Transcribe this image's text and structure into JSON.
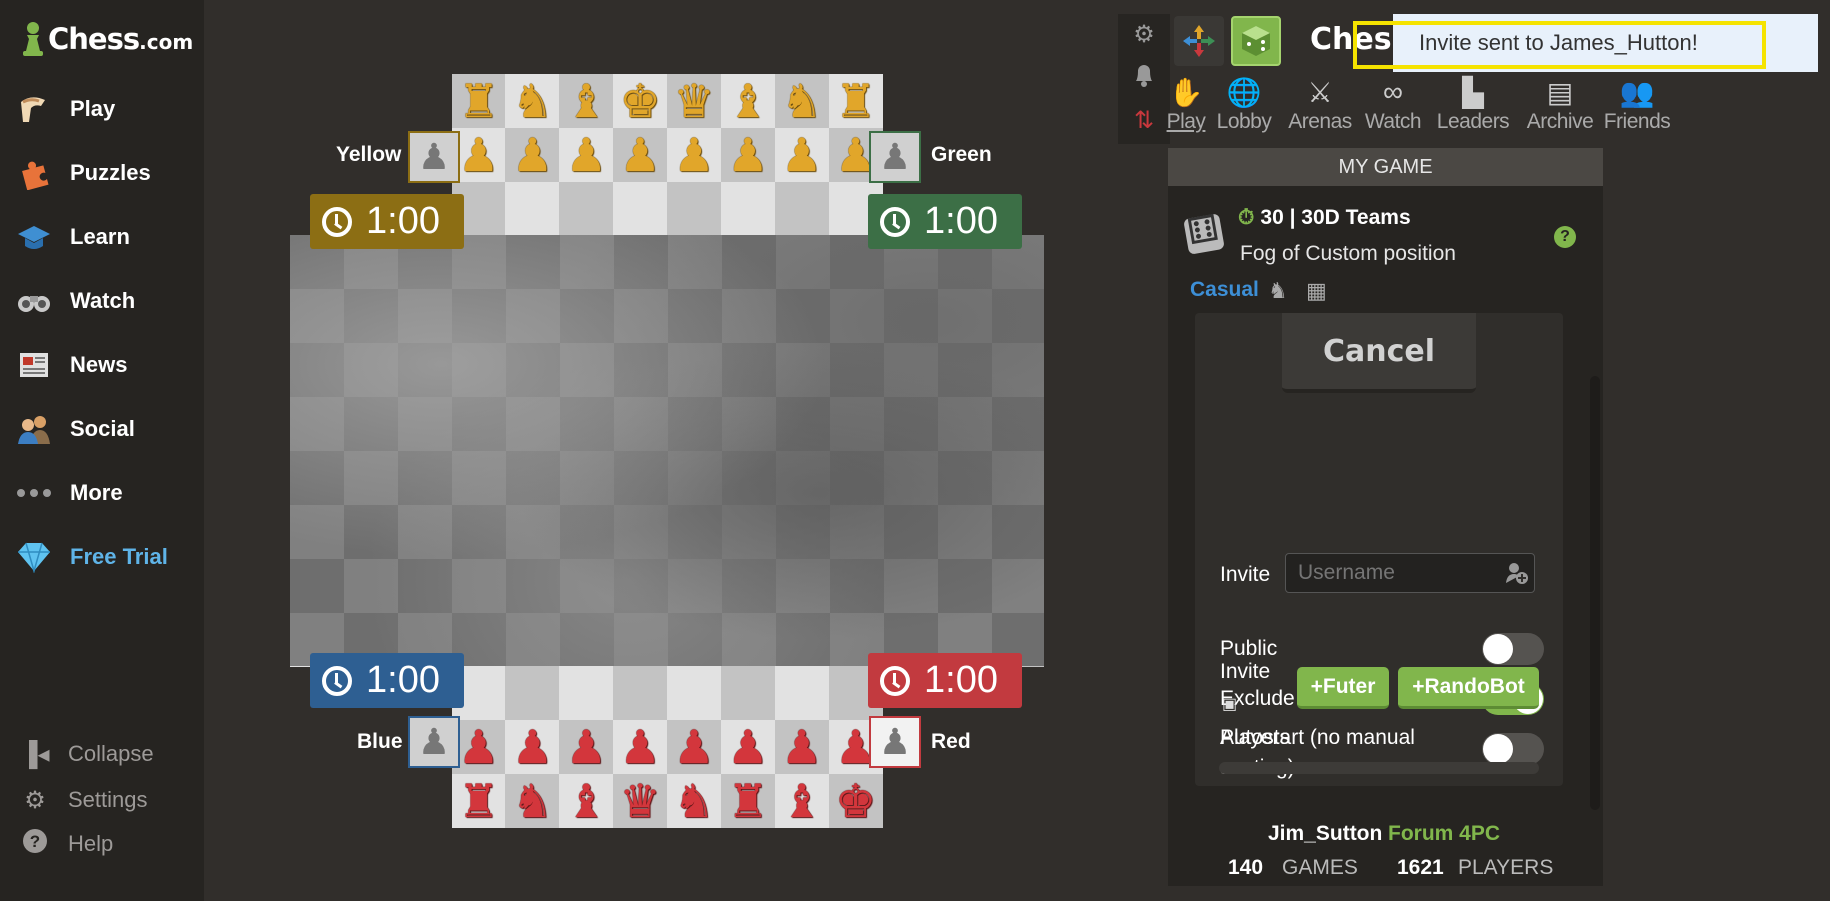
{
  "sidebar": {
    "logo": {
      "brand": "Chess",
      "tld": ".com"
    },
    "items": [
      {
        "label": "Play",
        "icon": "play-hand-icon"
      },
      {
        "label": "Puzzles",
        "icon": "puzzle-icon"
      },
      {
        "label": "Learn",
        "icon": "graduation-cap-icon"
      },
      {
        "label": "Watch",
        "icon": "binoculars-icon"
      },
      {
        "label": "News",
        "icon": "newspaper-icon"
      },
      {
        "label": "Social",
        "icon": "people-icon"
      },
      {
        "label": "More",
        "icon": "more-dots-icon"
      },
      {
        "label": "Free Trial",
        "icon": "diamond-icon"
      }
    ],
    "footer": [
      {
        "label": "Collapse",
        "icon": "collapse-icon"
      },
      {
        "label": "Settings",
        "icon": "gear-icon"
      },
      {
        "label": "Help",
        "icon": "help-icon"
      }
    ]
  },
  "board": {
    "players": {
      "yellow": {
        "name": "Yellow",
        "clock": "1:00",
        "color": "#8c6e14"
      },
      "green": {
        "name": "Green",
        "clock": "1:00",
        "color": "#3c6f46"
      },
      "blue": {
        "name": "Blue",
        "clock": "1:00",
        "color": "#2e5f92"
      },
      "red": {
        "name": "Red",
        "clock": "1:00",
        "color": "#c23a3f"
      }
    },
    "top_back_rank": [
      "♜",
      "♞",
      "♝",
      "♚",
      "♛",
      "♝",
      "♞",
      "♜"
    ],
    "top_pawns": [
      "♟",
      "♟",
      "♟",
      "♟",
      "♟",
      "♟",
      "♟",
      "♟"
    ],
    "bottom_pawns": [
      "♟",
      "♟",
      "♟",
      "♟",
      "♟",
      "♟",
      "♟",
      "♟"
    ],
    "bottom_back_rank": [
      "♜",
      "♞",
      "♝",
      "♛",
      "♞",
      "♜",
      "♝",
      "♚"
    ],
    "avatar_glyph": "♟"
  },
  "header": {
    "brand_partial": "Chess",
    "toast": "Invite sent to James_Hutton!"
  },
  "tabs": [
    {
      "label": "Play",
      "icon": "play-hand-icon",
      "glyph": "✋"
    },
    {
      "label": "Lobby",
      "icon": "globe-icon",
      "glyph": "🌐"
    },
    {
      "label": "Arenas",
      "icon": "crossed-swords-icon",
      "glyph": "⚔"
    },
    {
      "label": "Watch",
      "icon": "binoculars-icon",
      "glyph": "∞"
    },
    {
      "label": "Leaders",
      "icon": "podium-icon",
      "glyph": "▙"
    },
    {
      "label": "Archive",
      "icon": "archive-icon",
      "glyph": "▤"
    },
    {
      "label": "Friends",
      "icon": "friends-icon",
      "glyph": "👥"
    }
  ],
  "game": {
    "section_title": "MY GAME",
    "title": "30 | 30D Teams",
    "subtitle": "Fog of Custom position",
    "mode": "Casual",
    "cancel_label": "Cancel",
    "invite_label": "Invite",
    "invite_placeholder": "Username",
    "options": [
      {
        "label": "Public",
        "on": false
      },
      {
        "label": "Exclude me",
        "on": true
      },
      {
        "label": "Autostart (no manual seating)",
        "on": false
      }
    ],
    "invite_bots_label": "Invite",
    "bot_buttons": [
      "+Futer",
      "+RandoBot"
    ],
    "players_label": "Players"
  },
  "footer": {
    "user": "Jim_Sutton",
    "forum": "Forum 4PC",
    "games_count": "140",
    "games_label": "GAMES",
    "players_count": "1621",
    "players_label": "PLAYERS"
  },
  "colors": {
    "accent_green": "#81b64c",
    "link_blue": "#3d8fd6",
    "toast_border": "#f5e300"
  }
}
